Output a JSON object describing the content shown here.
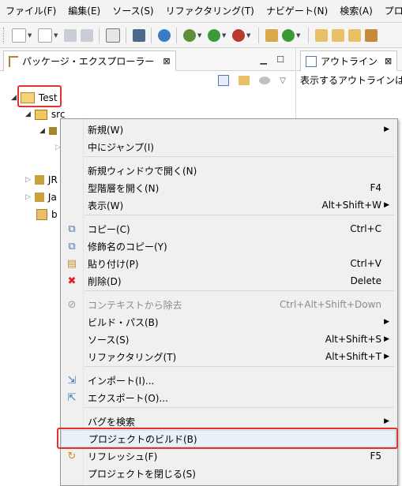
{
  "menubar": {
    "items": [
      "ファイル(F)",
      "編集(E)",
      "ソース(S)",
      "リファクタリング(T)",
      "ナビゲート(N)",
      "検索(A)",
      "プロ"
    ]
  },
  "package_view": {
    "tab_label": "パッケージ・エクスプローラー",
    "close_glyph": "⊠",
    "tree": {
      "project": "Test",
      "src": "src",
      "jr_partial": "JR",
      "ja_partial": "Ja",
      "b_partial": "b"
    }
  },
  "outline_view": {
    "tab_label": "アウトライン",
    "close_glyph": "⊠",
    "message": "表示するアウトラインは"
  },
  "context_menu": {
    "items": [
      {
        "label": "新規(W)",
        "shortcut": "",
        "submenu": true,
        "icon": ""
      },
      {
        "label": "中にジャンプ(I)",
        "shortcut": "",
        "submenu": false,
        "icon": ""
      },
      {
        "label": "新規ウィンドウで開く(N)",
        "shortcut": "",
        "submenu": false,
        "icon": ""
      },
      {
        "label": "型階層を開く(N)",
        "shortcut": "F4",
        "submenu": false,
        "icon": ""
      },
      {
        "label": "表示(W)",
        "shortcut": "Alt+Shift+W",
        "submenu": true,
        "icon": ""
      },
      {
        "label": "コピー(C)",
        "shortcut": "Ctrl+C",
        "submenu": false,
        "icon": "copy-icon"
      },
      {
        "label": "修飾名のコピー(Y)",
        "shortcut": "",
        "submenu": false,
        "icon": "copy-qualified-icon"
      },
      {
        "label": "貼り付け(P)",
        "shortcut": "Ctrl+V",
        "submenu": false,
        "icon": "paste-icon"
      },
      {
        "label": "削除(D)",
        "shortcut": "Delete",
        "submenu": false,
        "icon": "delete-icon"
      },
      {
        "label": "コンテキストから除去",
        "shortcut": "Ctrl+Alt+Shift+Down",
        "submenu": false,
        "icon": "remove-context-icon",
        "disabled": true
      },
      {
        "label": "ビルド・パス(B)",
        "shortcut": "",
        "submenu": true,
        "icon": ""
      },
      {
        "label": "ソース(S)",
        "shortcut": "Alt+Shift+S",
        "submenu": true,
        "icon": ""
      },
      {
        "label": "リファクタリング(T)",
        "shortcut": "Alt+Shift+T",
        "submenu": true,
        "icon": ""
      },
      {
        "label": "インポート(I)...",
        "shortcut": "",
        "submenu": false,
        "icon": "import-icon"
      },
      {
        "label": "エクスポート(O)...",
        "shortcut": "",
        "submenu": false,
        "icon": "export-icon"
      },
      {
        "label": "バグを検索",
        "shortcut": "",
        "submenu": true,
        "icon": ""
      },
      {
        "label": "プロジェクトのビルド(B)",
        "shortcut": "",
        "submenu": false,
        "icon": "",
        "highlighted": true
      },
      {
        "label": "リフレッシュ(F)",
        "shortcut": "F5",
        "submenu": false,
        "icon": "refresh-icon"
      },
      {
        "label": "プロジェクトを閉じる(S)",
        "shortcut": "",
        "submenu": false,
        "icon": ""
      }
    ]
  },
  "colors": {
    "highlight_border": "#e53030",
    "menu_bg": "#f0f0f0",
    "disabled_text": "#8c8c8c"
  }
}
